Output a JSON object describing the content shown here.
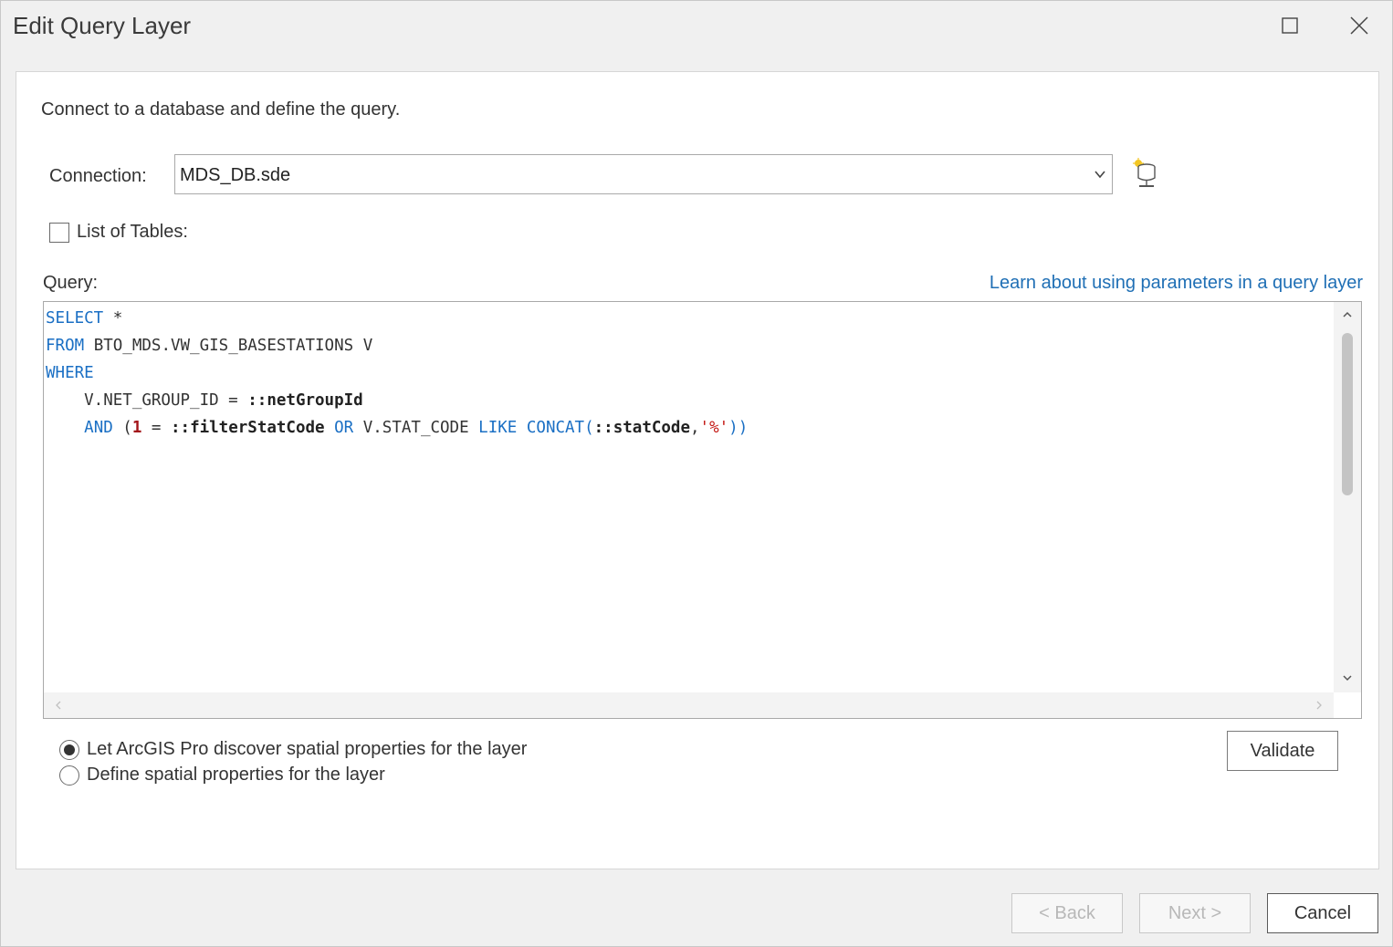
{
  "window": {
    "title": "Edit Query Layer",
    "maximize_icon": "maximize-icon",
    "close_icon": "close-icon"
  },
  "intro": "Connect to a database and define the query.",
  "connection": {
    "label": "Connection:",
    "value": "MDS_DB.sde",
    "new_connection_icon": "database-connection-icon"
  },
  "tables": {
    "label": "List of Tables:",
    "checked": false
  },
  "query": {
    "label": "Query:",
    "help_link": "Learn about using parameters in a query layer",
    "lines": [
      "SELECT *",
      "FROM BTO_MDS.VW_GIS_BASESTATIONS V",
      "WHERE",
      "    V.NET_GROUP_ID = ::netGroupId",
      "    AND (1 = ::filterStatCode OR V.STAT_CODE LIKE CONCAT(::statCode,'%'))"
    ]
  },
  "spatial": {
    "option_discover": "Let ArcGIS Pro discover spatial properties for the layer",
    "option_define": "Define spatial properties for the layer",
    "selected": "discover"
  },
  "buttons": {
    "validate": "Validate",
    "back": "< Back",
    "next": "Next >",
    "cancel": "Cancel"
  },
  "colors": {
    "keyword": "#1a6fc4",
    "number": "#a3151a",
    "string": "#c41a16",
    "link": "#1f6fb5"
  }
}
